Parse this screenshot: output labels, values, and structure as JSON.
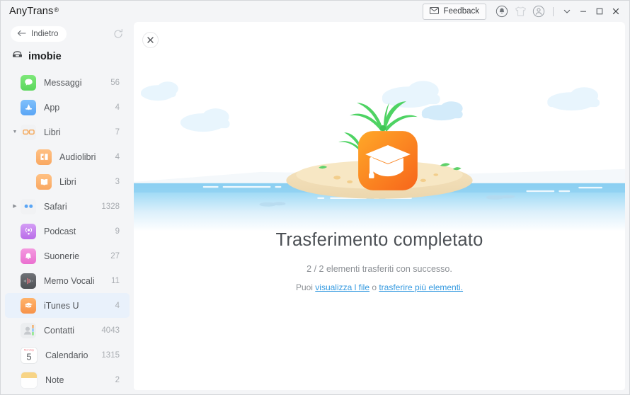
{
  "window": {
    "brand": "AnyTrans",
    "brand_superscript": "®"
  },
  "titlebar": {
    "feedback_label": "Feedback",
    "icons": {
      "feedback": "envelope-icon",
      "notifications": "bell-icon",
      "theme": "tshirt-icon",
      "account": "account-icon",
      "more": "chevron-down-icon",
      "minimize": "minimize-icon",
      "maximize": "maximize-icon",
      "close": "close-icon"
    }
  },
  "sidebar": {
    "back_label": "Indietro",
    "refresh_icon": "refresh-icon",
    "device_name": "imobie",
    "device_icon": "device-icon",
    "items": [
      {
        "label": "Messaggi",
        "count": "56",
        "icon": "messages-icon",
        "level": 0,
        "caret": "",
        "selected": false
      },
      {
        "label": "App",
        "count": "4",
        "icon": "appstore-icon",
        "level": 0,
        "caret": "",
        "selected": false
      },
      {
        "label": "Libri",
        "count": "7",
        "icon": "books-group-icon",
        "level": 0,
        "caret": "▼",
        "selected": false
      },
      {
        "label": "Audiolibri",
        "count": "4",
        "icon": "audiobooks-icon",
        "level": 1,
        "caret": "",
        "selected": false
      },
      {
        "label": "Libri",
        "count": "3",
        "icon": "book-icon",
        "level": 1,
        "caret": "",
        "selected": false
      },
      {
        "label": "Safari",
        "count": "1328",
        "icon": "safari-icon",
        "level": 0,
        "caret": "▶",
        "selected": false
      },
      {
        "label": "Podcast",
        "count": "9",
        "icon": "podcast-icon",
        "level": 0,
        "caret": "",
        "selected": false
      },
      {
        "label": "Suonerie",
        "count": "27",
        "icon": "ringtones-icon",
        "level": 0,
        "caret": "",
        "selected": false
      },
      {
        "label": "Memo Vocali",
        "count": "11",
        "icon": "voicememo-icon",
        "level": 0,
        "caret": "",
        "selected": false
      },
      {
        "label": "iTunes U",
        "count": "4",
        "icon": "itunesu-icon",
        "level": 0,
        "caret": "",
        "selected": true
      },
      {
        "label": "Contatti",
        "count": "4043",
        "icon": "contacts-icon",
        "level": 0,
        "caret": "",
        "selected": false
      },
      {
        "label": "Calendario",
        "count": "1315",
        "icon": "calendar-icon",
        "level": 0,
        "caret": "",
        "selected": false
      },
      {
        "label": "Note",
        "count": "2",
        "icon": "notes-icon",
        "level": 0,
        "caret": "",
        "selected": false
      }
    ]
  },
  "main": {
    "close_icon": "close-icon",
    "illustration": "island-itunesu-illustration",
    "title": "Trasferimento completato",
    "subtitle": "2 / 2 elementi trasferiti con successo.",
    "links_prefix": "Puoi ",
    "link_view": "visualizza l file",
    "links_middle": " o ",
    "link_more": "trasferire più elementi.",
    "calendar_day": "5"
  },
  "colors": {
    "accent_link": "#3399e0",
    "selected_row": "#e9f1fb",
    "sidebar_bg": "#f4f5f7",
    "panel_bg": "#ffffff",
    "itunesu_orange": "#f7931e",
    "water_blue": "#7ec8f0"
  }
}
